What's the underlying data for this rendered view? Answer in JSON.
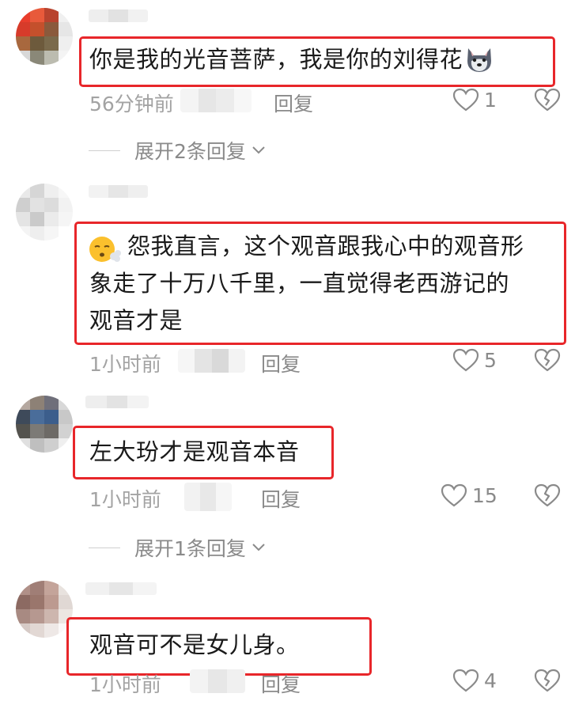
{
  "comments": [
    {
      "text": "你是我的光音菩萨，我是你的刘得花",
      "time": "56分钟前",
      "reply_label": "回复",
      "likes": "1",
      "emoji_end": "wolf-face-emoji",
      "avatar_colors": [
        "#e93d2c",
        "#e85a3b",
        "#b8432e",
        "#f0f0f0",
        "#d73b2a",
        "#c4502c",
        "#8a5a3c",
        "#e6e6e6",
        "#a8683e",
        "#6d5a3c",
        "#7a6a4c",
        "#efefef",
        "#d8d8d8",
        "#8a8878",
        "#bcbcb0",
        "#f4f4f4"
      ]
    },
    {
      "text_lines": [
        "怨我直言，这个观音跟我心中的观音形",
        "象走了十万八千里，一直觉得老西游记的",
        "观音才是"
      ],
      "time": "1小时前",
      "reply_label": "回复",
      "likes": "5",
      "emoji_start": "face-with-steam-emoji",
      "avatar_colors": [
        "#e9e9e9",
        "#d6d6d6",
        "#efefef",
        "#f7f7f7",
        "#cfcfcf",
        "#e2e2e2",
        "#dcdcdc",
        "#f2f2f2",
        "#e4e4e4",
        "#cacaca",
        "#ebebeb",
        "#f5f5f5",
        "#f4f4f4",
        "#eeeeee",
        "#f6f6f6",
        "#ffffff"
      ]
    },
    {
      "text": "左大玢才是观音本音",
      "time": "1小时前",
      "reply_label": "回复",
      "likes": "15",
      "avatar_colors": [
        "#b5a8a0",
        "#8d8176",
        "#6f6f7a",
        "#d8d8d8",
        "#3e4a5a",
        "#4a6d9a",
        "#3c5e8c",
        "#c8c8c8",
        "#54534e",
        "#7c7a76",
        "#6d6a66",
        "#d2d2d2",
        "#e0e0e0",
        "#bfbfbf",
        "#cfcfcf",
        "#efefef"
      ]
    },
    {
      "text": "观音可不是女儿身。",
      "time": "1小时前",
      "reply_label": "回复",
      "likes": "4",
      "avatar_colors": [
        "#b09088",
        "#a07e76",
        "#c4a49a",
        "#e8e2de",
        "#8c6a62",
        "#9a766c",
        "#bc9a90",
        "#e0d8d4",
        "#a88a82",
        "#b69890",
        "#cdb6ae",
        "#ece6e2",
        "#d6cac6",
        "#e2d8d4",
        "#eee8e6",
        "#faf8f8"
      ]
    }
  ],
  "expanders": [
    {
      "label": "展开2条回复"
    },
    {
      "label": "展开1条回复"
    }
  ],
  "colors": {
    "highlight_border": "#e8262a",
    "meta_text": "#a3a3a3",
    "body_text": "#1a1a1a"
  }
}
